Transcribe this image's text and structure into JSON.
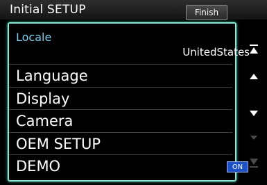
{
  "header": {
    "title": "Initial SETUP",
    "finish_label": "Finish"
  },
  "list": {
    "locale": {
      "label": "Locale",
      "value": "UnitedStates"
    },
    "items": [
      {
        "label": "Language"
      },
      {
        "label": "Display"
      },
      {
        "label": "Camera"
      },
      {
        "label": "OEM SETUP"
      },
      {
        "label": "DEMO",
        "badge": "ON"
      }
    ]
  },
  "scroll": {
    "icons": [
      "scroll-top-icon",
      "scroll-up-icon",
      "scroll-down-icon",
      "scroll-page-down-icon",
      "scroll-bottom-icon"
    ]
  },
  "colors": {
    "accent_frame": "#8be5d2",
    "locale_label": "#7fd0f0",
    "badge_on": "#1d52c7"
  }
}
